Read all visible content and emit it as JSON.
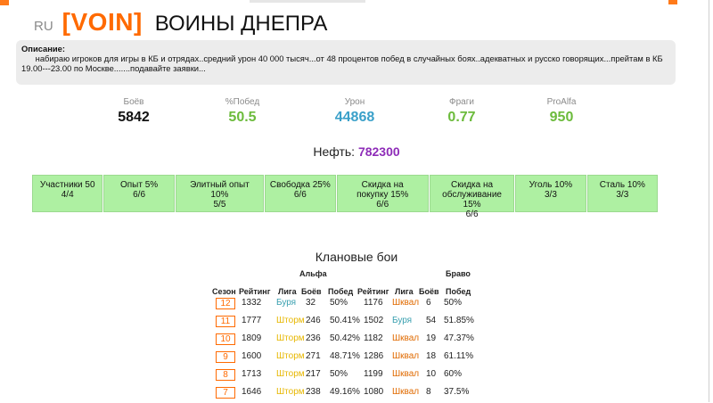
{
  "clan": {
    "lang": "RU",
    "tag": "[VOIN]",
    "name": "ВОИНЫ ДНЕПРА"
  },
  "description": {
    "label": "Описание:",
    "text": "набираю игроков для игры в КБ и отрядах..средний урон 40 000 тысяч...от 48 процентов побед в случайных боях..адекватных и русско говорящих...прейтам в КБ 19.00---23.00 по Москве.......подавайте заявки..."
  },
  "stats": [
    {
      "label": "Боёв",
      "value": "5842",
      "color": "#111111"
    },
    {
      "label": "%Побед",
      "value": "50.5",
      "color": "#6cbb3c"
    },
    {
      "label": "Урон",
      "value": "44868",
      "color": "#3aa0c9"
    },
    {
      "label": "Фраги",
      "value": "0.77",
      "color": "#6cbb3c"
    },
    {
      "label": "ProAlfa",
      "value": "950",
      "color": "#6cbb3c"
    }
  ],
  "oil": {
    "label": "Нефть:",
    "value": "782300"
  },
  "bonuses": [
    {
      "line1": "Участники 50",
      "line2": "4/4"
    },
    {
      "line1": "Опыт 5%",
      "line2": "6/6"
    },
    {
      "line1": "Элитный опыт 10%",
      "line2": "5/5"
    },
    {
      "line1": "Свободка 25%",
      "line2": "6/6"
    },
    {
      "line1": "Скидка на покупку 15%",
      "line2": "6/6"
    },
    {
      "line1": "Скидка на обслуживание 15%",
      "line2": "6/6"
    },
    {
      "line1": "Уголь 10%",
      "line2": "3/3"
    },
    {
      "line1": "Сталь 10%",
      "line2": "3/3"
    }
  ],
  "clanwars": {
    "title": "Клановые бои",
    "group_alpha": "Альфа",
    "group_bravo": "Браво",
    "columns": {
      "season": "Сезон",
      "rating": "Рейтинг",
      "league": "Лига",
      "battles": "Боёв",
      "wins": "Побед"
    },
    "rows": [
      {
        "season": "12",
        "a_rating": "1332",
        "a_league": "Буря",
        "a_battles": "32",
        "a_wins": "50%",
        "b_rating": "1176",
        "b_league": "Шквал",
        "b_battles": "6",
        "b_wins": "50%"
      },
      {
        "season": "11",
        "a_rating": "1777",
        "a_league": "Шторм",
        "a_battles": "246",
        "a_wins": "50.41%",
        "b_rating": "1502",
        "b_league": "Буря",
        "b_battles": "54",
        "b_wins": "51.85%"
      },
      {
        "season": "10",
        "a_rating": "1809",
        "a_league": "Шторм",
        "a_battles": "236",
        "a_wins": "50.42%",
        "b_rating": "1182",
        "b_league": "Шквал",
        "b_battles": "19",
        "b_wins": "47.37%"
      },
      {
        "season": "9",
        "a_rating": "1600",
        "a_league": "Шторм",
        "a_battles": "271",
        "a_wins": "48.71%",
        "b_rating": "1286",
        "b_league": "Шквал",
        "b_battles": "18",
        "b_wins": "61.11%"
      },
      {
        "season": "8",
        "a_rating": "1713",
        "a_league": "Шторм",
        "a_battles": "217",
        "a_wins": "50%",
        "b_rating": "1199",
        "b_league": "Шквал",
        "b_battles": "10",
        "b_wins": "60%"
      },
      {
        "season": "7",
        "a_rating": "1646",
        "a_league": "Шторм",
        "a_battles": "238",
        "a_wins": "49.16%",
        "b_rating": "1080",
        "b_league": "Шквал",
        "b_battles": "8",
        "b_wins": "37.5%"
      }
    ]
  }
}
